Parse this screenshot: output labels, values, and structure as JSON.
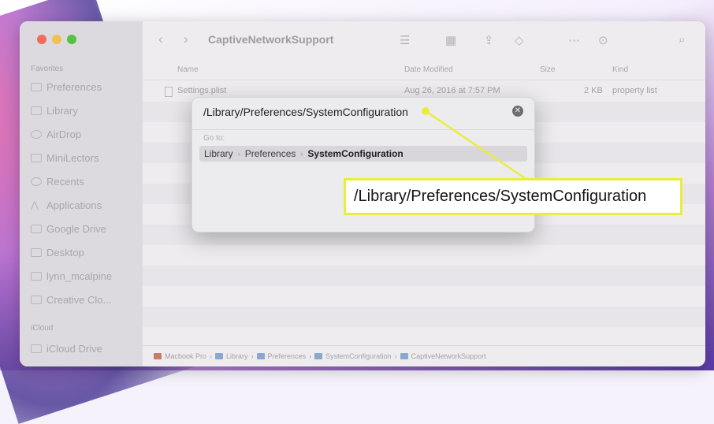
{
  "window": {
    "title": "CaptiveNetworkSupport"
  },
  "sidebar": {
    "favorites_header": "Favorites",
    "items": [
      {
        "label": "Preferences",
        "icon": "folder-icon"
      },
      {
        "label": "Library",
        "icon": "folder-icon"
      },
      {
        "label": "AirDrop",
        "icon": "airdrop-icon"
      },
      {
        "label": "MiniLectors",
        "icon": "folder-icon"
      },
      {
        "label": "Recents",
        "icon": "clock-icon"
      },
      {
        "label": "Applications",
        "icon": "applications-icon"
      },
      {
        "label": "Google Drive",
        "icon": "drive-icon"
      },
      {
        "label": "Desktop",
        "icon": "desktop-icon"
      },
      {
        "label": "lynn_mcalpine",
        "icon": "home-icon"
      },
      {
        "label": "Creative Clo...",
        "icon": "cloud-icon"
      }
    ],
    "icloud_header": "iCloud",
    "icloud_items": [
      {
        "label": "iCloud Drive",
        "icon": "cloud-icon"
      }
    ]
  },
  "columns": {
    "name": "Name",
    "date_modified": "Date Modified",
    "size": "Size",
    "kind": "Kind"
  },
  "files": [
    {
      "name": "Settings.plist",
      "date": "Aug 26, 2016 at 7:57 PM",
      "size": "2 KB",
      "kind": "property list"
    }
  ],
  "pathbar": [
    "Macbook Pro",
    "Library",
    "Preferences",
    "SystemConfiguration",
    "CaptiveNetworkSupport"
  ],
  "goto_dialog": {
    "input_value": "/Library/Preferences/SystemConfiguration",
    "goto_label": "Go to:",
    "suggestion": [
      "Library",
      "Preferences",
      "SystemConfiguration"
    ]
  },
  "callout": {
    "text": "/Library/Preferences/SystemConfiguration",
    "border_color": "#ecec3c"
  },
  "colors": {
    "traffic_close": "#f26b5d",
    "traffic_min": "#f4bf4f",
    "traffic_max": "#52c43f"
  }
}
